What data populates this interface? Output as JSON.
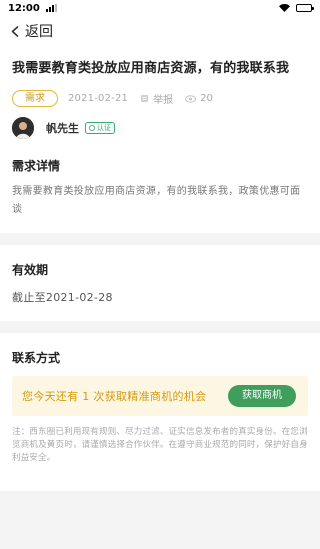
{
  "status_bar": {
    "time": "12:00"
  },
  "nav": {
    "back_label": "返回"
  },
  "post": {
    "title": "我需要教育类投放应用商店资源，有的我联系我",
    "tag": "需求",
    "date": "2021-02-21",
    "report_label": "举报",
    "views": "20",
    "author_name": "帆先生",
    "verified_label": "认证"
  },
  "details": {
    "title": "需求详情",
    "text": "我需要教育类投放应用商店资源，有的我联系我，政策优惠可面谈"
  },
  "validity": {
    "title": "有效期",
    "text": "截止至2021-02-28"
  },
  "contact": {
    "title": "联系方式",
    "banner_text": "您今天还有 1 次获取精准商机的机会",
    "button_label": "获取商机",
    "note": "注：西东圈已利用现有规则、尽力过滤、证实信息发布者的真实身份。在您浏览商机及黄页时，请谨慎选择合作伙伴。在遵守商业规范的同时，保护好自身利益安全。"
  },
  "colors": {
    "accent_green": "#3f9e5c",
    "tag_yellow": "#e0b83e",
    "banner_bg": "#fdf6e3",
    "banner_text": "#d59a0a"
  }
}
